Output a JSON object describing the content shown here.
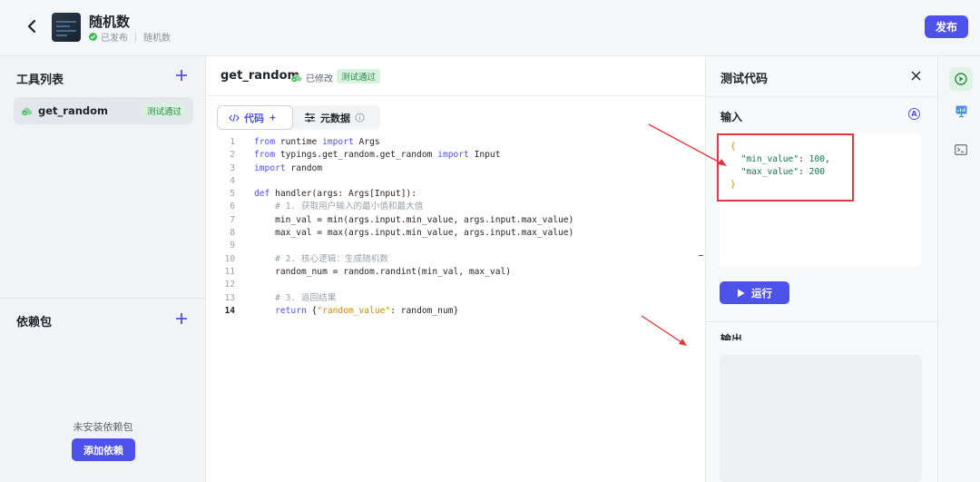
{
  "header": {
    "title": "随机数",
    "status": "已发布",
    "subtitle": "随机数",
    "publish_label": "发布"
  },
  "left": {
    "tools_title": "工具列表",
    "tools": [
      {
        "name": "get_random",
        "badge": "测试通过"
      }
    ],
    "deps_title": "依赖包",
    "deps_empty": "未安装依赖包",
    "add_dep_label": "添加依赖"
  },
  "editor": {
    "file_name": "get_random",
    "modified_label": "已修改",
    "test_badge": "测试通过",
    "tab_code": "代码",
    "tab_meta": "元数据",
    "current_line": 14,
    "lines": [
      "from runtime import Args",
      "from typings.get_random.get_random import Input",
      "import random",
      "",
      "def handler(args: Args[Input]):",
      "    # 1. 获取用户输入的最小值和最大值",
      "    min_val = min(args.input.min_value, args.input.max_value)",
      "    max_val = max(args.input.min_value, args.input.max_value)",
      "",
      "    # 2. 核心逻辑：生成随机数",
      "    random_num = random.randint(min_val, max_val)",
      "",
      "    # 3. 返回结果",
      "    return {\"random_value\": random_num}"
    ]
  },
  "test_panel": {
    "title": "测试代码",
    "input_label": "输入",
    "input_json": {
      "open": "{",
      "k1": "\"min_value\"",
      "v1": "100",
      "k2": "\"max_value\"",
      "v2": "200",
      "close": "}"
    },
    "run_label": "运行",
    "output_label": "输出"
  },
  "colors": {
    "accent": "#4d53e8",
    "success": "#3fb950",
    "annotation": "#e0393e"
  },
  "icons": {
    "back": "chevron-left-icon",
    "close": "close-icon",
    "run": "play-icon",
    "rail": [
      "test-run-icon",
      "monitor-icon",
      "terminal-icon"
    ]
  }
}
